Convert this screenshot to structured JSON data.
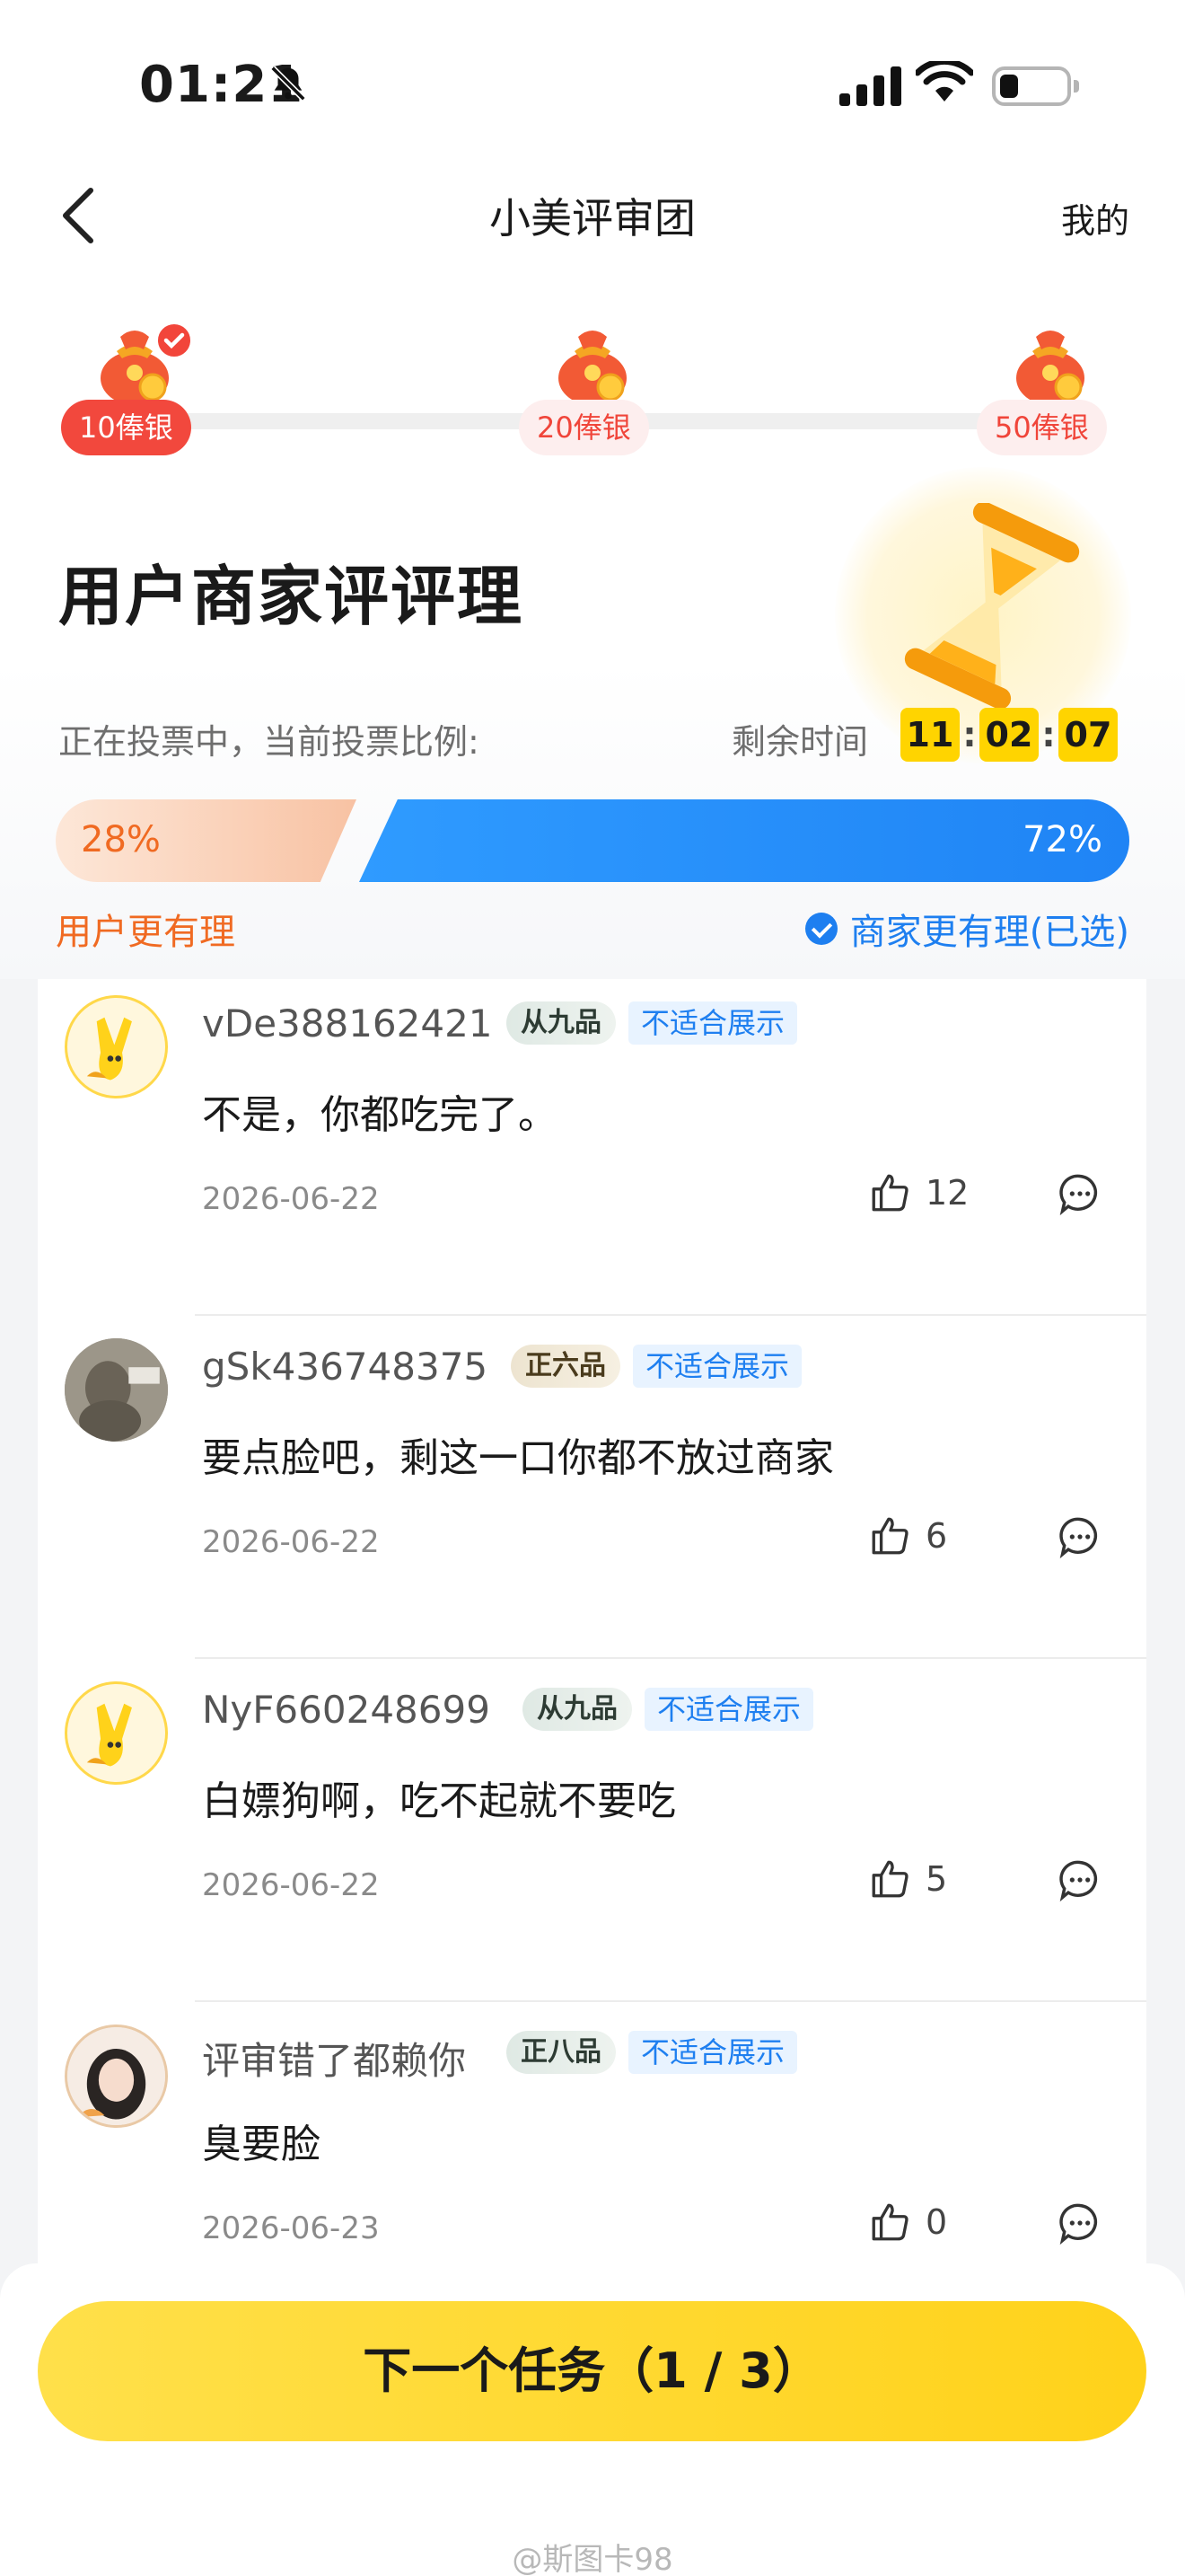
{
  "status_bar": {
    "time": "01:21"
  },
  "nav": {
    "title": "小美评审团",
    "mine": "我的"
  },
  "rewards": [
    {
      "label": "10俸银",
      "claimed": true
    },
    {
      "label": "20俸银",
      "claimed": false
    },
    {
      "label": "50俸银",
      "claimed": false
    }
  ],
  "case": {
    "title": "用户商家评评理",
    "vote_status": "正在投票中，当前投票比例:",
    "remaining_label": "剩余时间",
    "timer": {
      "hours": "11",
      "minutes": "02",
      "seconds": "07",
      "sep": ":"
    },
    "user_percent": "28%",
    "merchant_percent": "72%",
    "user_side": "用户更有理",
    "merchant_side": "商家更有理(已选)"
  },
  "comments": [
    {
      "user": "vDe388162421",
      "rank": "从九品",
      "tag": "不适合展示",
      "text": "不是，你都吃完了。",
      "date": "2026-06-22",
      "likes": "12"
    },
    {
      "user": "gSk436748375",
      "rank": "正六品",
      "tag": "不适合展示",
      "text": "要点脸吧，剩这一口你都不放过商家",
      "date": "2026-06-22",
      "likes": "6"
    },
    {
      "user": "NyF660248699",
      "rank": "从九品",
      "tag": "不适合展示",
      "text": "白嫖狗啊，吃不起就不要吃",
      "date": "2026-06-22",
      "likes": "5"
    },
    {
      "user": "评审错了都赖你",
      "rank": "正八品",
      "tag": "不适合展示",
      "text": "臭要脸",
      "date": "2026-06-23",
      "likes": "0"
    }
  ],
  "next_button": "下一个任务（1 / 3）",
  "watermark": "@斯图卡98",
  "colors": {
    "accent_yellow": "#ffd400",
    "merchant_blue": "#1e7ff0",
    "user_orange": "#f06a22",
    "reward_red": "#f2483d"
  }
}
